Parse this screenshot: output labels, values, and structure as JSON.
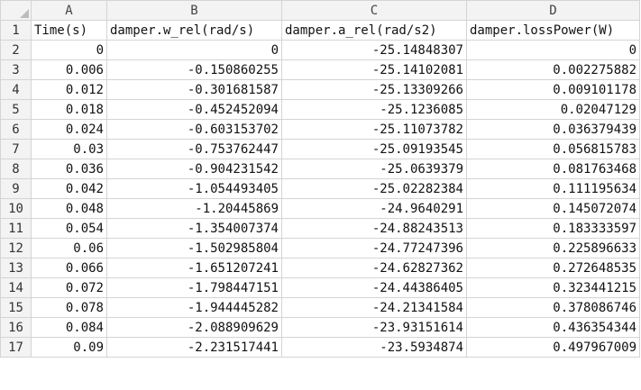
{
  "columns": [
    "A",
    "B",
    "C",
    "D"
  ],
  "rows": [
    {
      "num": "1",
      "cells": [
        "Time(s)",
        "damper.w_rel(rad/s)",
        "damper.a_rel(rad/s2)",
        "damper.lossPower(W)"
      ]
    },
    {
      "num": "2",
      "cells": [
        "0",
        "0",
        "-25.14848307",
        "0"
      ]
    },
    {
      "num": "3",
      "cells": [
        "0.006",
        "-0.150860255",
        "-25.14102081",
        "0.002275882"
      ]
    },
    {
      "num": "4",
      "cells": [
        "0.012",
        "-0.301681587",
        "-25.13309266",
        "0.009101178"
      ]
    },
    {
      "num": "5",
      "cells": [
        "0.018",
        "-0.452452094",
        "-25.1236085",
        "0.02047129"
      ]
    },
    {
      "num": "6",
      "cells": [
        "0.024",
        "-0.603153702",
        "-25.11073782",
        "0.036379439"
      ]
    },
    {
      "num": "7",
      "cells": [
        "0.03",
        "-0.753762447",
        "-25.09193545",
        "0.056815783"
      ]
    },
    {
      "num": "8",
      "cells": [
        "0.036",
        "-0.904231542",
        "-25.0639379",
        "0.081763468"
      ]
    },
    {
      "num": "9",
      "cells": [
        "0.042",
        "-1.054493405",
        "-25.02282384",
        "0.111195634"
      ]
    },
    {
      "num": "10",
      "cells": [
        "0.048",
        "-1.20445869",
        "-24.9640291",
        "0.145072074"
      ]
    },
    {
      "num": "11",
      "cells": [
        "0.054",
        "-1.354007374",
        "-24.88243513",
        "0.183333597"
      ]
    },
    {
      "num": "12",
      "cells": [
        "0.06",
        "-1.502985804",
        "-24.77247396",
        "0.225896633"
      ]
    },
    {
      "num": "13",
      "cells": [
        "0.066",
        "-1.651207241",
        "-24.62827362",
        "0.272648535"
      ]
    },
    {
      "num": "14",
      "cells": [
        "0.072",
        "-1.798447151",
        "-24.44386405",
        "0.323441215"
      ]
    },
    {
      "num": "15",
      "cells": [
        "0.078",
        "-1.944445282",
        "-24.21341584",
        "0.378086746"
      ]
    },
    {
      "num": "16",
      "cells": [
        "0.084",
        "-2.088909629",
        "-23.93151614",
        "0.436354344"
      ]
    },
    {
      "num": "17",
      "cells": [
        "0.09",
        "-2.231517441",
        "-23.5934874",
        "0.497967009"
      ]
    }
  ]
}
